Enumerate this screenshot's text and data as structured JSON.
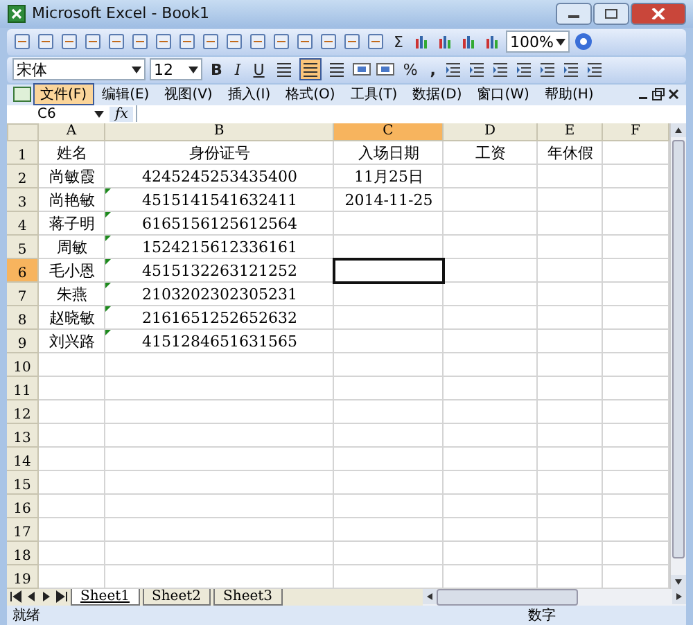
{
  "window": {
    "title": "Microsoft Excel - Book1"
  },
  "standard_toolbar": {
    "zoom": "100%",
    "sum": "Σ"
  },
  "format_toolbar": {
    "font": "宋体",
    "size": "12",
    "bold": "B",
    "italic": "I",
    "underline": "U",
    "percent": "%",
    "comma": ",",
    "alignment_buttons": [
      {
        "selected": false
      },
      {
        "selected": true
      },
      {
        "selected": false
      }
    ]
  },
  "menu": [
    {
      "label": "文件(F)",
      "selected": true
    },
    {
      "label": "编辑(E)",
      "selected": false
    },
    {
      "label": "视图(V)",
      "selected": false
    },
    {
      "label": "插入(I)",
      "selected": false
    },
    {
      "label": "格式(O)",
      "selected": false
    },
    {
      "label": "工具(T)",
      "selected": false
    },
    {
      "label": "数据(D)",
      "selected": false
    },
    {
      "label": "窗口(W)",
      "selected": false
    },
    {
      "label": "帮助(H)",
      "selected": false
    }
  ],
  "formula_bar": {
    "name_box": "C6",
    "fx": "fx"
  },
  "columns": [
    {
      "label": "A",
      "selected": false
    },
    {
      "label": "B",
      "selected": false
    },
    {
      "label": "C",
      "selected": true
    },
    {
      "label": "D",
      "selected": false
    },
    {
      "label": "E",
      "selected": false
    },
    {
      "label": "F",
      "selected": false
    }
  ],
  "rows": [
    {
      "number": "1",
      "selected": false,
      "flag": false,
      "cells": [
        "姓名",
        "身份证号",
        "入场日期",
        "工资",
        "年休假"
      ]
    },
    {
      "number": "2",
      "selected": false,
      "flag": false,
      "cells": [
        "尚敏霞",
        "4245245253435400",
        "11月25日"
      ]
    },
    {
      "number": "3",
      "selected": false,
      "flag": true,
      "cells": [
        "尚艳敏",
        "4515141541632411",
        "2014-11-25"
      ]
    },
    {
      "number": "4",
      "selected": false,
      "flag": true,
      "cells": [
        "蒋子明",
        "6165156125612564"
      ]
    },
    {
      "number": "5",
      "selected": false,
      "flag": true,
      "cells": [
        "周敏",
        "1524215612336161"
      ]
    },
    {
      "number": "6",
      "selected": true,
      "flag": true,
      "cells": [
        "毛小恩",
        "4515132263121252"
      ]
    },
    {
      "number": "7",
      "selected": false,
      "flag": true,
      "cells": [
        "朱燕",
        "2103202302305231"
      ]
    },
    {
      "number": "8",
      "selected": false,
      "flag": true,
      "cells": [
        "赵晓敏",
        "2161651252652632"
      ]
    },
    {
      "number": "9",
      "selected": false,
      "flag": true,
      "cells": [
        "刘兴路",
        "4151284651631565"
      ]
    },
    {
      "number": "10",
      "selected": false,
      "flag": false,
      "cells": []
    },
    {
      "number": "11",
      "selected": false,
      "flag": false,
      "cells": []
    },
    {
      "number": "12",
      "selected": false,
      "flag": false,
      "cells": []
    },
    {
      "number": "13",
      "selected": false,
      "flag": false,
      "cells": []
    },
    {
      "number": "14",
      "selected": false,
      "flag": false,
      "cells": []
    },
    {
      "number": "15",
      "selected": false,
      "flag": false,
      "cells": []
    },
    {
      "number": "16",
      "selected": false,
      "flag": false,
      "cells": []
    },
    {
      "number": "17",
      "selected": false,
      "flag": false,
      "cells": []
    },
    {
      "number": "18",
      "selected": false,
      "flag": false,
      "cells": []
    },
    {
      "number": "19",
      "selected": false,
      "flag": false,
      "cells": []
    }
  ],
  "sheet_tabs": [
    {
      "label": "Sheet1",
      "selected": true
    },
    {
      "label": "Sheet2",
      "selected": false
    },
    {
      "label": "Sheet3",
      "selected": false
    }
  ],
  "status_bar": {
    "left": "就绪",
    "mode": "数字"
  }
}
